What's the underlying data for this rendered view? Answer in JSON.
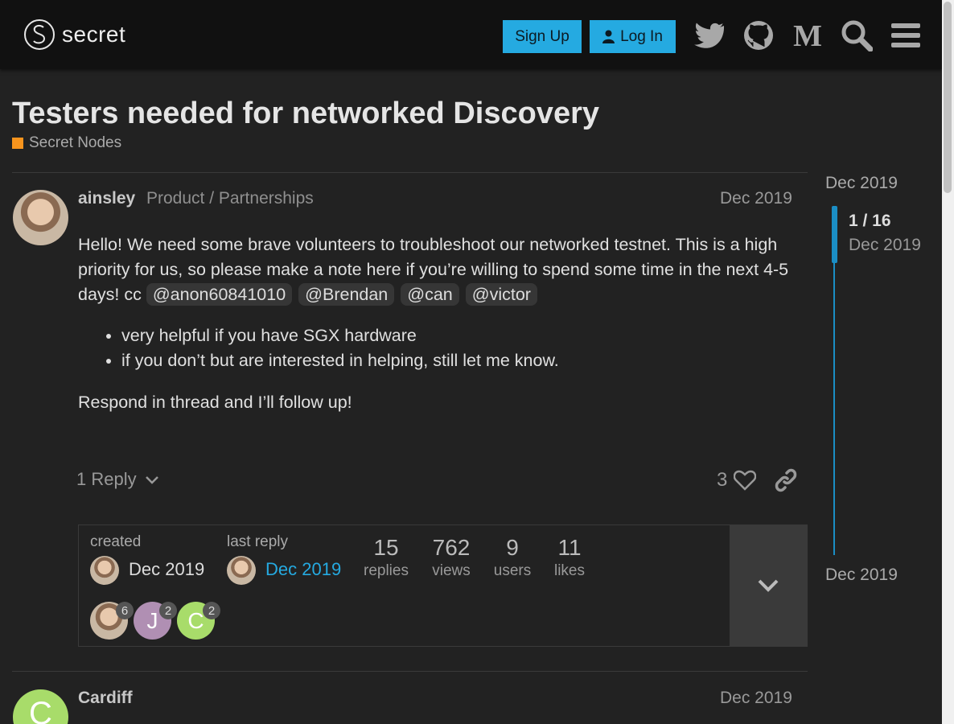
{
  "header": {
    "logo_text": "secret",
    "signup_label": "Sign Up",
    "login_label": "Log In",
    "icons": [
      "twitter-icon",
      "github-icon",
      "medium-icon",
      "search-icon",
      "menu-icon"
    ],
    "accent": "#25aae1"
  },
  "topic": {
    "title": "Testers needed for networked Discovery",
    "category": "Secret Nodes",
    "category_color": "#f7941d"
  },
  "post": {
    "username": "ainsley",
    "user_title": "Product / Partnerships",
    "date": "Dec 2019",
    "body_intro": "Hello! We need some brave volunteers to troubleshoot our networked testnet. This is a high priority for us, so please make a note here if you’re willing to spend some time in the next 4-5 days! cc ",
    "mentions": [
      "@anon60841010",
      "@Brendan",
      "@can",
      "@victor"
    ],
    "bullets": [
      "very helpful if you have SGX hardware",
      "if you don’t but are interested in helping, still let me know."
    ],
    "closing": "Respond in thread and I’ll follow up!",
    "replies_label": "1 Reply",
    "like_count": "3"
  },
  "summary": {
    "created_label": "created",
    "created_date": "Dec 2019",
    "last_reply_label": "last reply",
    "last_reply_date": "Dec 2019",
    "stats": [
      {
        "num": "15",
        "label": "replies"
      },
      {
        "num": "762",
        "label": "views"
      },
      {
        "num": "9",
        "label": "users"
      },
      {
        "num": "11",
        "label": "likes"
      }
    ],
    "participants": [
      {
        "letter": "",
        "count": "6",
        "color": "#c9b8a4"
      },
      {
        "letter": "J",
        "count": "2",
        "color": "#b08fb3"
      },
      {
        "letter": "C",
        "count": "2",
        "color": "#a8dc6a"
      }
    ]
  },
  "timeline": {
    "top_date": "Dec 2019",
    "counter": "1 / 16",
    "current_date": "Dec 2019",
    "bottom_date": "Dec 2019"
  },
  "next_post": {
    "username": "Cardiff",
    "date": "Dec 2019",
    "avatar_letter": "C"
  }
}
